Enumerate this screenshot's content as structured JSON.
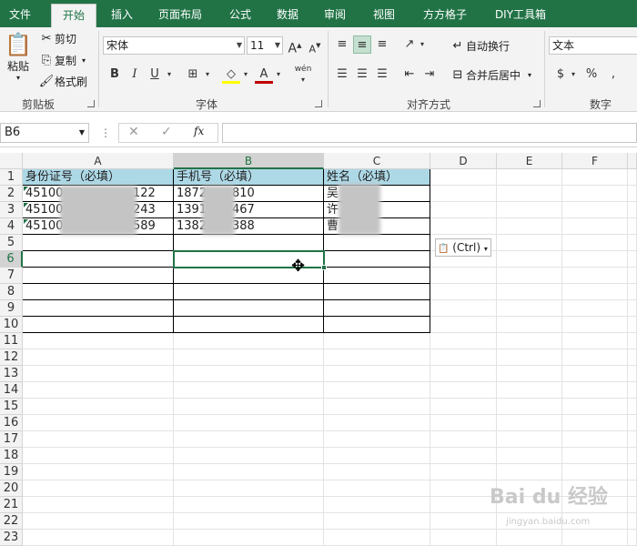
{
  "tabs": [
    "文件",
    "开始",
    "插入",
    "页面布局",
    "公式",
    "数据",
    "审阅",
    "视图",
    "方方格子",
    "DIY工具箱"
  ],
  "active_tab": "开始",
  "clipboard": {
    "paste_label": "粘贴",
    "cut_label": "剪切",
    "copy_label": "复制",
    "format_painter_label": "格式刷",
    "group_label": "剪贴板"
  },
  "font": {
    "font_name": "宋体",
    "font_size": "11",
    "bold": "B",
    "italic": "I",
    "underline": "U",
    "increase_size": "A",
    "decrease_size": "A",
    "font_color_glyph": "A",
    "phonetic_glyph": "wén",
    "group_label": "字体"
  },
  "alignment": {
    "wrap_text_label": "自动换行",
    "merge_center_label": "合并后居中",
    "group_label": "对齐方式"
  },
  "number": {
    "format_value": "文本",
    "currency": "$",
    "percent": "%",
    "group_label": "数字"
  },
  "formula_bar": {
    "name_box": "B6",
    "fx_label": "fx",
    "value": ""
  },
  "columns": [
    "A",
    "B",
    "C",
    "D",
    "E",
    "F"
  ],
  "rows": [
    "1",
    "2",
    "3",
    "4",
    "5",
    "6",
    "7",
    "8",
    "9",
    "10",
    "11",
    "12",
    "13",
    "14",
    "15",
    "16",
    "17",
    "18",
    "19",
    "20",
    "21",
    "22",
    "23"
  ],
  "table": {
    "headers": [
      "身份证号（必填）",
      "手机号（必填）",
      "姓名（必填）"
    ],
    "rows": [
      {
        "id_start": "45100",
        "id_end": "122",
        "phone_start": "1872",
        "phone_end": "810",
        "name_start": "吴"
      },
      {
        "id_start": "45100",
        "id_end": "243",
        "phone_start": "1391",
        "phone_end": "467",
        "name_start": "许"
      },
      {
        "id_start": "45100",
        "id_end": "589",
        "phone_start": "1382",
        "phone_end": "388",
        "name_start": "曹"
      }
    ]
  },
  "selected_cell": "B6",
  "paste_options_label": "(Ctrl)",
  "watermark": {
    "main": "Bai du 经验",
    "sub": "jingyan.baidu.com"
  },
  "colors": {
    "excel_green": "#217346",
    "header_fill": "#add8e6"
  }
}
